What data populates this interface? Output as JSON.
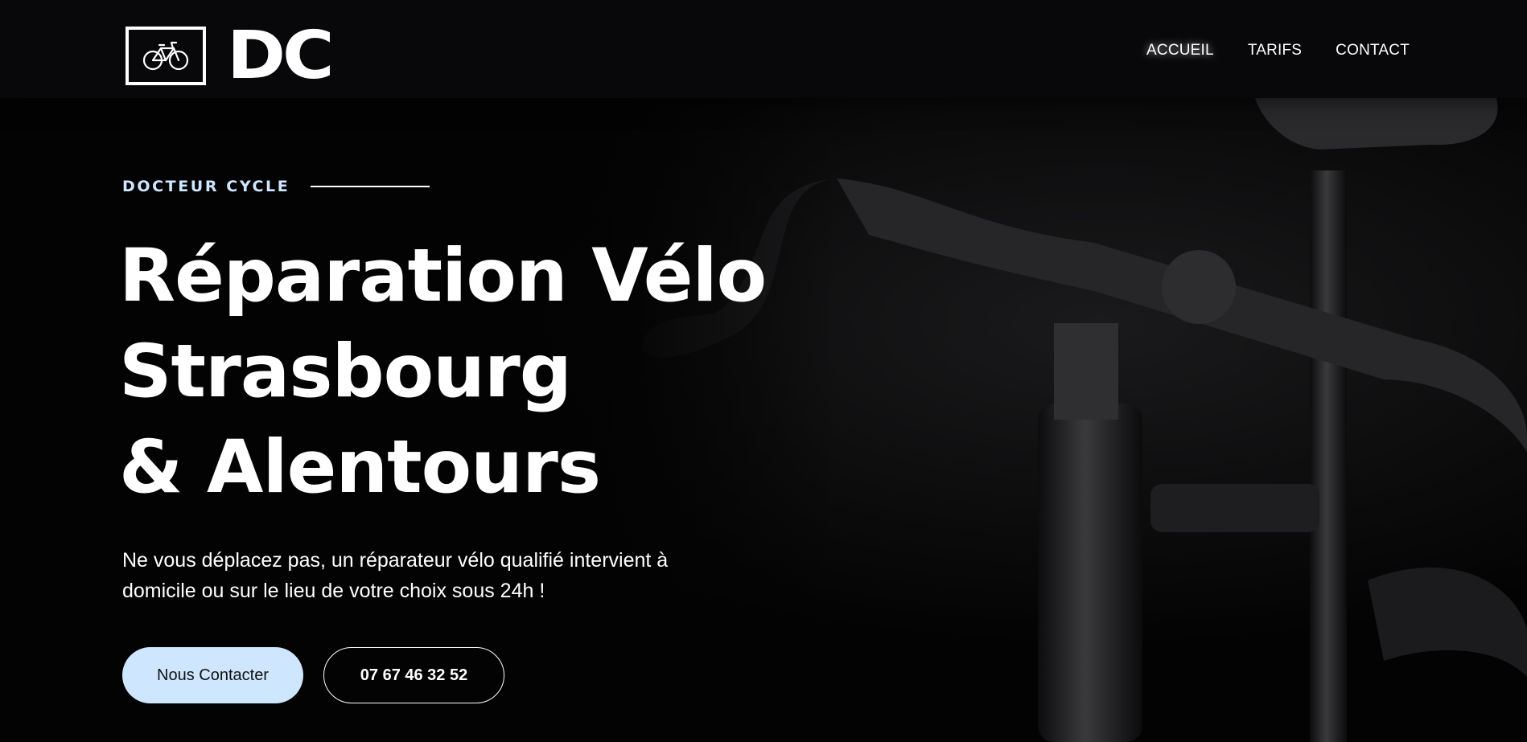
{
  "brand": {
    "logo_text": "DC",
    "logo_icon": "bicycle-icon"
  },
  "nav": {
    "items": [
      {
        "label": "ACCUEIL"
      },
      {
        "label": "TARIFS"
      },
      {
        "label": "CONTACT"
      }
    ]
  },
  "hero": {
    "eyebrow": "DOCTEUR CYCLE",
    "title_lines": [
      "Réparation Vélo",
      "Strasbourg",
      "& Alentours"
    ],
    "lead_line1": "Ne vous déplacez pas, un réparateur vélo qualifié intervient à",
    "lead_line2": "domicile ou sur le lieu de votre choix sous 24h !",
    "primary_button": "Nous Contacter",
    "phone_button": "07 67 46 32 52",
    "image": "bicycle-handlebar-photo"
  },
  "colors": {
    "background": "#050505",
    "header": "#08080b",
    "accent": "#cfe6ff",
    "text": "#ffffff"
  }
}
